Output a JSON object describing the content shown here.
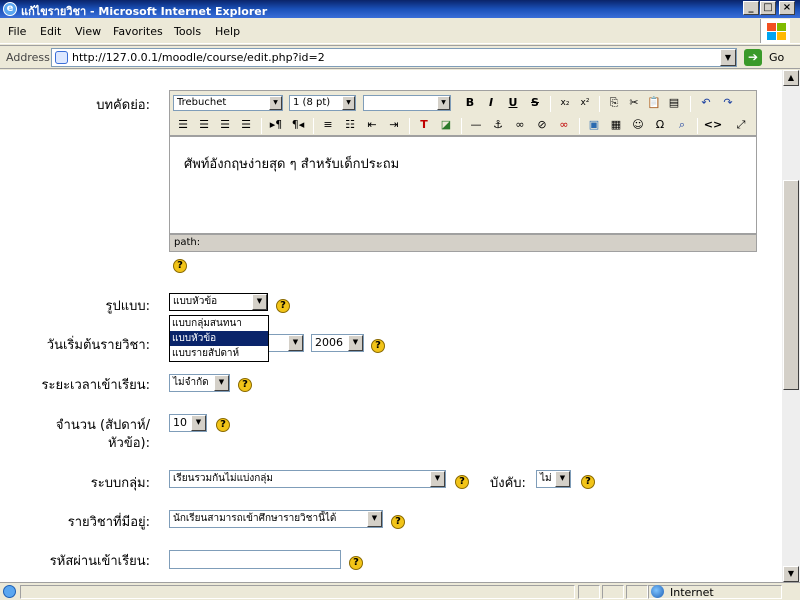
{
  "window": {
    "title": "แก้ไขรายวิชา - Microsoft Internet Explorer",
    "controls": [
      "_",
      "□",
      "×"
    ]
  },
  "menu": [
    "File",
    "Edit",
    "View",
    "Favorites",
    "Tools",
    "Help"
  ],
  "address": {
    "label": "Address",
    "url": "http://127.0.0.1/moodle/course/edit.php?id=2",
    "go_label": "Go"
  },
  "editor": {
    "field_label": "บทคัดย่อ:",
    "font": "Trebuchet",
    "size": "1 (8 pt)",
    "style": "",
    "content": "ศัพท์อังกฤษง่ายสุด ๆ สำหรับเด็กประถม",
    "path_label": "path:"
  },
  "form": {
    "format": {
      "label": "รูปแบบ:",
      "value": "แบบหัวข้อ",
      "options": [
        "แบบกลุ่มสนทนา",
        "แบบหัวข้อ",
        "แบบรายสัปดาห์"
      ],
      "selected_index": 1
    },
    "startdate": {
      "label": "วันเริ่มต้นรายวิชา:",
      "year": "2006"
    },
    "enrolperiod": {
      "label": "ระยะเวลาเข้าเรียน:",
      "value": "ไม่จำกัด"
    },
    "numsections": {
      "label_line1": "จำนวน (สัปดาห์/",
      "label_line2": "หัวข้อ):",
      "value": "10"
    },
    "groupmode": {
      "label": "ระบบกลุ่ม:",
      "value": "เรียนรวมกันไม่แบ่งกลุ่ม",
      "force_label": "บังคับ:",
      "force_value": "ไม่"
    },
    "visible": {
      "label": "รายวิชาที่มีอยู่:",
      "value": "นักเรียนสามารถเข้าศึกษารายวิชานี้ได้"
    },
    "password": {
      "label": "รหัสผ่านเข้าเรียน:",
      "value": ""
    },
    "help_glyph": "?"
  },
  "status": {
    "zone": "Internet"
  }
}
